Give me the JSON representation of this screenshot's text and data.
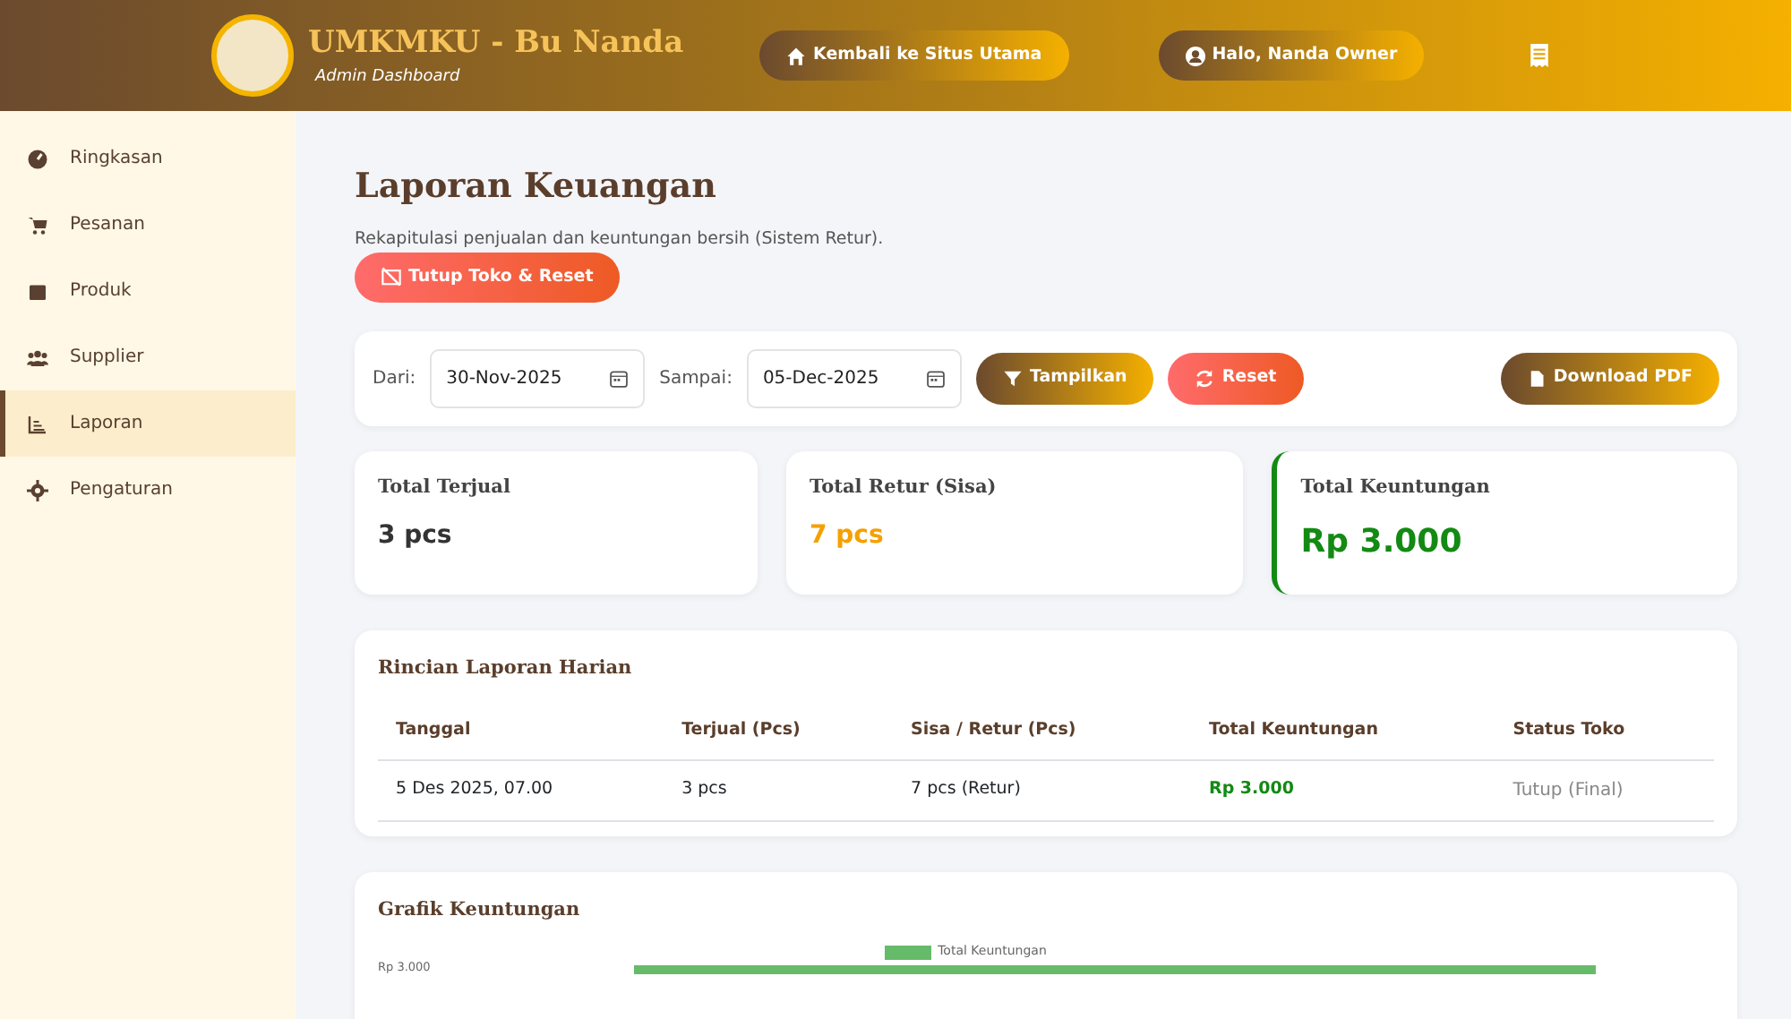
{
  "header": {
    "brand": "UMKMKU - Bu Nanda",
    "subtitle": "Admin Dashboard",
    "home_button": "Kembali ke Situs Utama",
    "user_button": "Halo, Nanda Owner"
  },
  "sidebar": {
    "items": [
      {
        "label": "Ringkasan",
        "selected": false
      },
      {
        "label": "Pesanan",
        "selected": false
      },
      {
        "label": "Produk",
        "selected": false
      },
      {
        "label": "Supplier",
        "selected": false
      },
      {
        "label": "Laporan",
        "selected": true
      },
      {
        "label": "Pengaturan",
        "selected": false
      }
    ]
  },
  "page": {
    "title": "Laporan Keuangan",
    "description": "Rekapitulasi penjualan dan keuntungan bersih (Sistem Retur).",
    "close_button": "Tutup Toko & Reset"
  },
  "filter": {
    "from_label": "Dari:",
    "from_value": "30-Nov-2025",
    "to_label": "Sampai:",
    "to_value": "05-Dec-2025",
    "show_button": "Tampilkan",
    "reset_button": "Reset",
    "pdf_button": "Download PDF"
  },
  "stats": [
    {
      "label": "Total Terjual",
      "value": "3 pcs",
      "kind": "plain"
    },
    {
      "label": "Total Retur (Sisa)",
      "value": "7 pcs",
      "kind": "warning"
    },
    {
      "label": "Total Keuntungan",
      "value": "Rp 3.000",
      "kind": "profit"
    }
  ],
  "daily": {
    "title": "Rincian Laporan Harian",
    "columns": [
      "Tanggal",
      "Terjual (Pcs)",
      "Sisa / Retur (Pcs)",
      "Total Keuntungan",
      "Status Toko"
    ],
    "rows": [
      [
        "5 Des 2025, 07.00",
        "3 pcs",
        "7 pcs (Retur)",
        "Rp 3.000",
        "Tutup (Final)"
      ]
    ]
  },
  "chart": {
    "title": "Grafik Keuntungan",
    "legend": "Total Keuntungan",
    "tick_label": "Rp 3.000"
  }
}
